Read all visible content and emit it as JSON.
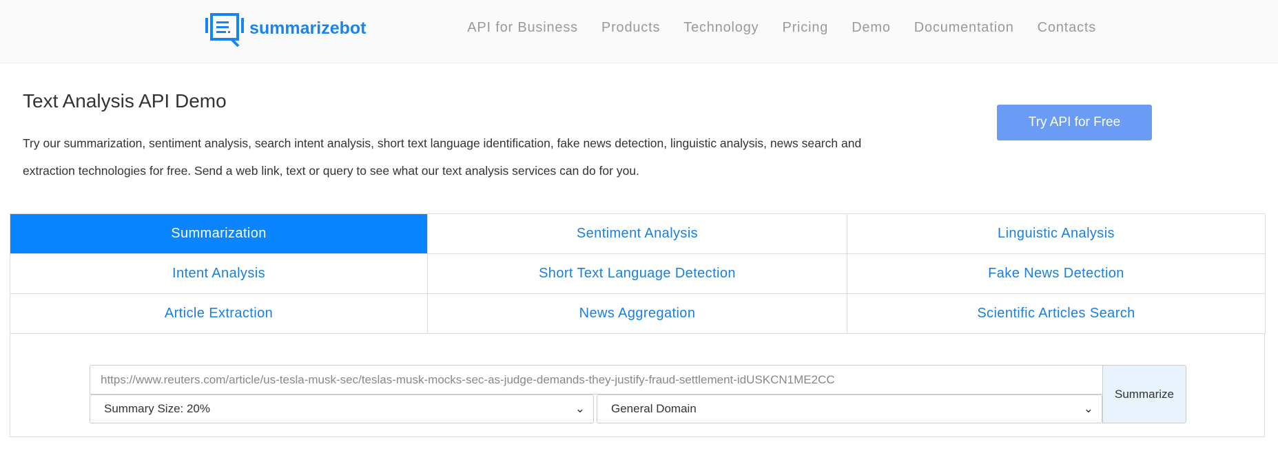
{
  "header": {
    "logo_text": "summarizebot",
    "menu": [
      "API for Business",
      "Products",
      "Technology",
      "Pricing",
      "Demo",
      "Documentation",
      "Contacts"
    ]
  },
  "main": {
    "title": "Text Analysis API Demo",
    "intro": "Try our summarization, sentiment analysis, search intent analysis, short text language identification, fake news detection, linguistic analysis, news search and extraction technologies for free. Send a web link, text or query to see what our text analysis services can do for you.",
    "try_button": "Try API for Free"
  },
  "tabs": [
    "Summarization",
    "Sentiment Analysis",
    "Linguistic Analysis",
    "Intent Analysis",
    "Short Text Language Detection",
    "Fake News Detection",
    "Article Extraction",
    "News Aggregation",
    "Scientific Articles Search"
  ],
  "form": {
    "url_value": "https://www.reuters.com/article/us-tesla-musk-sec/teslas-musk-mocks-sec-as-judge-demands-they-justify-fraud-settlement-idUSKCN1ME2CC",
    "size_select": "Summary Size: 20%",
    "domain_select": "General Domain",
    "submit": "Summarize"
  }
}
